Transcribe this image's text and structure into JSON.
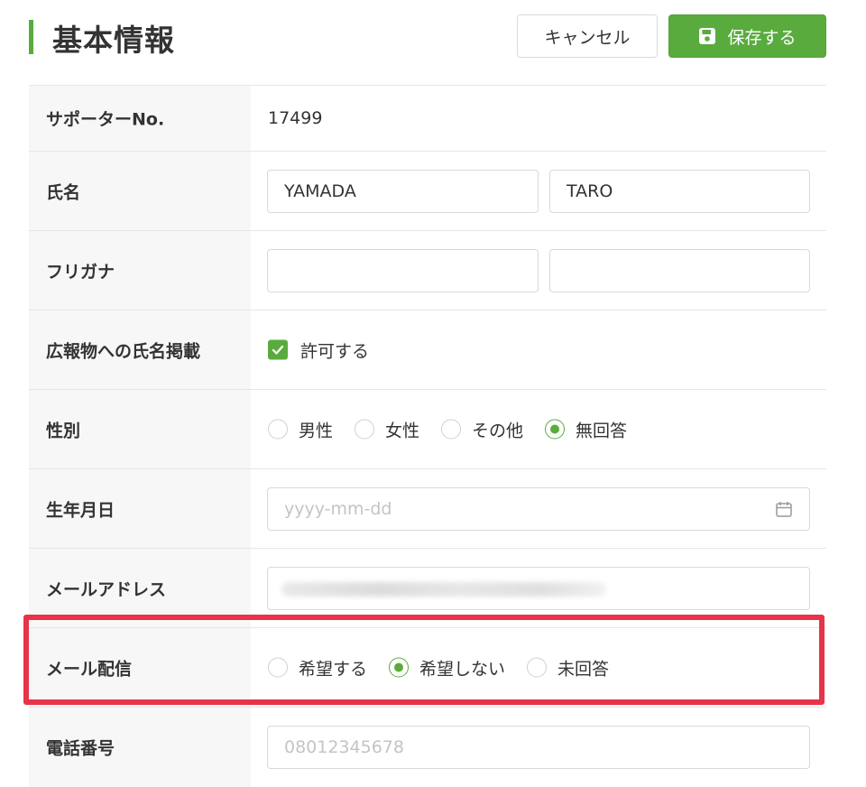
{
  "header": {
    "title": "基本情報",
    "cancel_label": "キャンセル",
    "save_label": "保存する"
  },
  "colors": {
    "accent": "#5aab3e",
    "highlight": "#e8334a"
  },
  "form": {
    "supporter_no": {
      "label": "サポーターNo.",
      "value": "17499"
    },
    "name": {
      "label": "氏名",
      "last_value": "YAMADA",
      "first_value": "TARO"
    },
    "furigana": {
      "label": "フリガナ",
      "last_value": "",
      "first_value": ""
    },
    "publish_name": {
      "label": "広報物への氏名掲載",
      "checkbox_label": "許可する",
      "checked": true
    },
    "gender": {
      "label": "性別",
      "options": [
        "男性",
        "女性",
        "その他",
        "無回答"
      ],
      "selected": "無回答"
    },
    "birthday": {
      "label": "生年月日",
      "placeholder": "yyyy-mm-dd",
      "icon": "calendar-icon"
    },
    "email": {
      "label": "メールアドレス",
      "value_obscured": true
    },
    "mail_delivery": {
      "label": "メール配信",
      "options": [
        "希望する",
        "希望しない",
        "未回答"
      ],
      "selected": "希望しない"
    },
    "phone": {
      "label": "電話番号",
      "placeholder": "08012345678"
    }
  }
}
